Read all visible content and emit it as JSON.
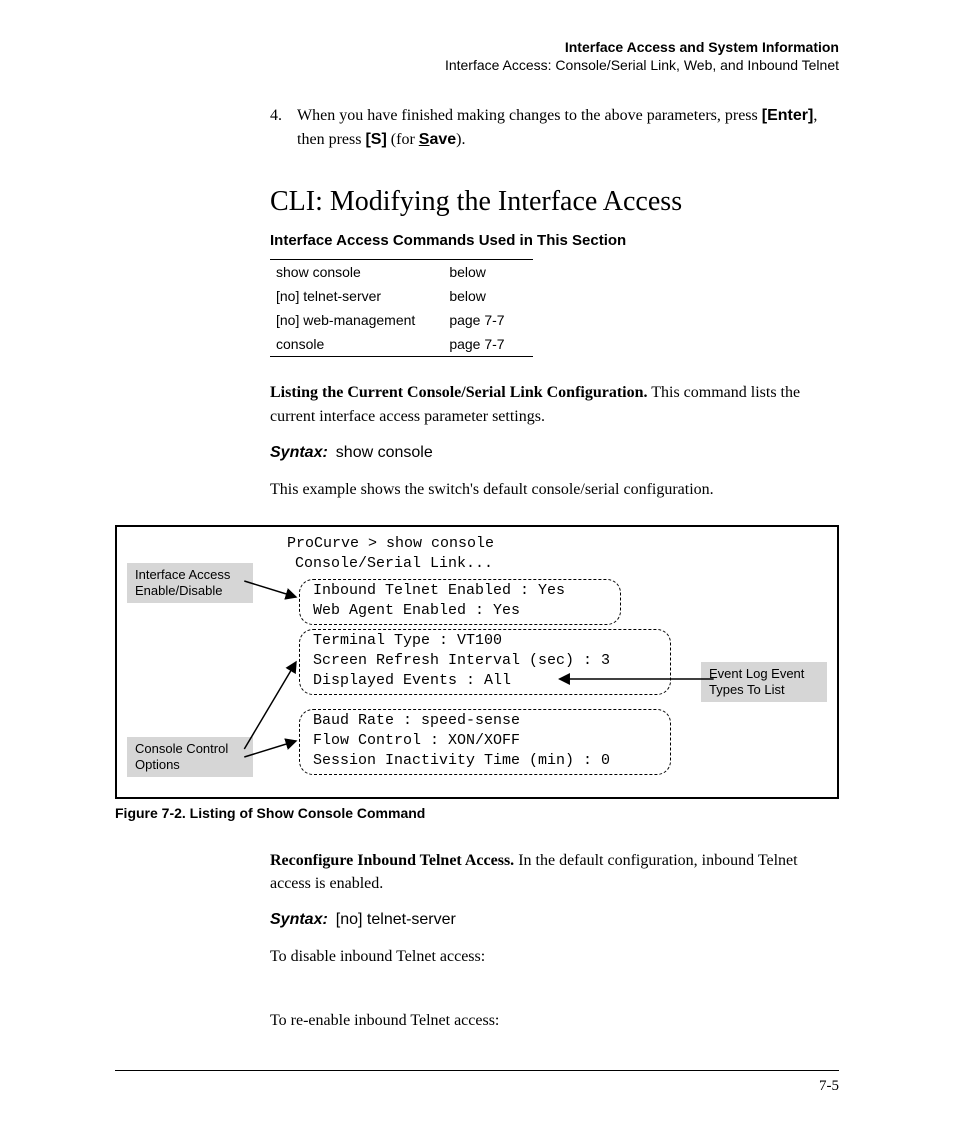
{
  "header": {
    "title": "Interface Access and System Information",
    "subtitle": "Interface Access: Console/Serial Link, Web, and Inbound Telnet"
  },
  "step": {
    "num": "4.",
    "text_a": "When you have finished making changes to the above parameters, press ",
    "key1": "[Enter]",
    "text_b": ", then press ",
    "key2": "[S]",
    "text_c": " (for ",
    "save_u": "S",
    "save_rest": "ave",
    "text_d": ")."
  },
  "section_title": "CLI: Modifying the Interface Access",
  "table_heading": "Interface Access Commands Used in This Section",
  "cmd_table": [
    {
      "cmd": "show console",
      "ref": "below"
    },
    {
      "cmd": "[no] telnet-server",
      "ref": "below"
    },
    {
      "cmd": "[no] web-management",
      "ref": "page 7-7"
    },
    {
      "cmd": "console",
      "ref": "page 7-7"
    }
  ],
  "listing": {
    "runin": "Listing the Current Console/Serial Link Configuration.",
    "body": "  This command lists the current interface access parameter settings."
  },
  "syntax1": {
    "label": "Syntax:",
    "cmd": "show console"
  },
  "example_text": "This example shows the switch's default console/serial configuration.",
  "figure": {
    "prompt": "ProCurve > show console",
    "subtitle": "Console/Serial Link...",
    "l1": "Inbound Telnet Enabled : Yes",
    "l2": "Web Agent Enabled : Yes",
    "l3": "Terminal Type : VT100",
    "l4": "Screen Refresh Interval (sec) : 3",
    "l5": "Displayed Events : All",
    "l6": "Baud Rate : speed-sense",
    "l7": "Flow Control : XON/XOFF",
    "l8": "Session Inactivity Time (min) : 0",
    "callout1": "Interface Access Enable/Disable",
    "callout2": "Console Control Options",
    "callout3": "Event Log Event Types To List"
  },
  "figcaption": "Figure 7-2.   Listing of Show Console Command",
  "reconfig": {
    "runin": "Reconfigure Inbound Telnet Access.",
    "body": "  In the default configuration, inbound Telnet access is enabled."
  },
  "syntax2": {
    "label": "Syntax:",
    "cmd": "[no] telnet-server"
  },
  "disable_text": "To disable inbound Telnet access:",
  "reenable_text": "To re-enable inbound Telnet access:",
  "page_number": "7-5"
}
